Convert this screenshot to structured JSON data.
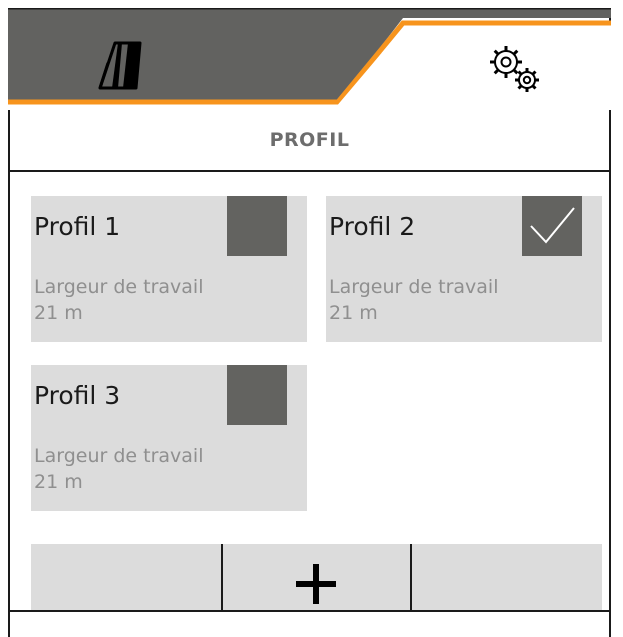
{
  "tabs": [
    {
      "name": "field-view-tab",
      "icon": "field-tracks-icon",
      "active": false
    },
    {
      "name": "settings-tab",
      "icon": "gears-icon",
      "active": true
    }
  ],
  "colors": {
    "tab_inactive_bg": "#626260",
    "accent": "#f7941d",
    "card_bg": "#dcdcdc",
    "checkbox_bg": "#636360",
    "title_text": "#6d6d6d"
  },
  "page": {
    "title": "PROFIL"
  },
  "profiles": [
    {
      "name": "Profil 1",
      "desc_label": "Largeur de travail",
      "desc_value": "21 m",
      "selected": false
    },
    {
      "name": "Profil 2",
      "desc_label": "Largeur de travail",
      "desc_value": "21 m",
      "selected": true
    },
    {
      "name": "Profil 3",
      "desc_label": "Largeur de travail",
      "desc_value": "21 m",
      "selected": false
    }
  ],
  "toolbar": {
    "buttons": [
      {
        "name": "toolbar-empty-left",
        "icon": ""
      },
      {
        "name": "add-profile-button",
        "icon": "plus-icon"
      },
      {
        "name": "toolbar-empty-right",
        "icon": ""
      }
    ]
  }
}
